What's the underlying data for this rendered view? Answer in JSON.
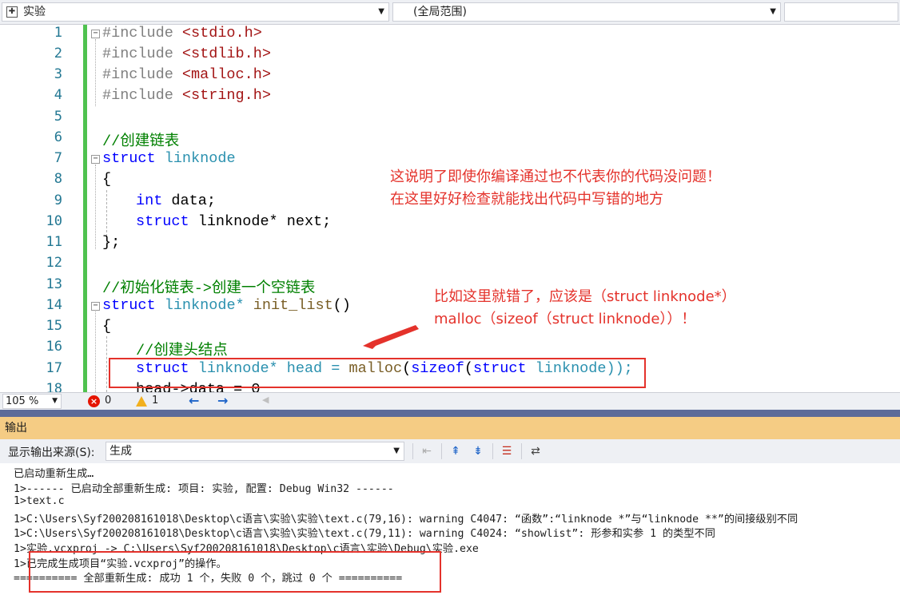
{
  "navbar": {
    "project": "实验",
    "scope": "(全局范围)"
  },
  "editor": {
    "line_numbers": [
      "1",
      "2",
      "3",
      "4",
      "5",
      "6",
      "7",
      "8",
      "9",
      "10",
      "11",
      "12",
      "13",
      "14",
      "15",
      "16",
      "17",
      "18"
    ],
    "lines": {
      "l1a": "#include ",
      "l1b": "<stdio.h>",
      "l2a": "#include ",
      "l2b": "<stdlib.h>",
      "l3a": "#include ",
      "l3b": "<malloc.h>",
      "l4a": "#include ",
      "l4b": "<string.h>",
      "l6": "//创建链表",
      "l7a": "struct",
      "l7b": " linknode",
      "l8": "{",
      "l9a": "int",
      "l9b": " data;",
      "l10a": "struct",
      "l10b": " linknode* next;",
      "l11": "};",
      "l13": "//初始化链表->创建一个空链表",
      "l14a": "struct",
      "l14b": " linknode* ",
      "l14c": "init_list",
      "l14d": "()",
      "l15": "{",
      "l16": "//创建头结点",
      "l17a": "struct",
      "l17b": " linknode* head = ",
      "l17c": "malloc",
      "l17d": "(",
      "l17e": "sizeof",
      "l17f": "(",
      "l17g": "struct",
      "l17h": " linknode));",
      "l18": "head->data = 0"
    },
    "annotations": {
      "note1_line1": "这说明了即使你编译通过也不代表你的代码没问题！",
      "note1_line2": "在这里好好检查就能找出代码中写错的地方",
      "note2_line1": "比如这里就错了，应该是（struct linknode*）",
      "note2_line2": "malloc（sizeof（struct linknode））！"
    }
  },
  "status": {
    "zoom": "105 %",
    "errors": "0",
    "warnings": "1"
  },
  "output": {
    "title": "输出",
    "source_label": "显示输出来源(S):",
    "source_value": "生成",
    "lines": [
      "已启动重新生成…",
      "1>------ 已启动全部重新生成: 项目: 实验, 配置: Debug Win32 ------",
      "1>text.c",
      "1>C:\\Users\\Syf200208161018\\Desktop\\c语言\\实验\\实验\\text.c(79,16): warning C4047: “函数”:“linknode *”与“linknode **”的间接级别不同",
      "1>C:\\Users\\Syf200208161018\\Desktop\\c语言\\实验\\实验\\text.c(79,11): warning C4024: “showlist”: 形参和实参 1 的类型不同",
      "1>实验.vcxproj -> C:\\Users\\Syf200208161018\\Desktop\\c语言\\实验\\Debug\\实验.exe",
      "1>已完成生成项目“实验.vcxproj”的操作。",
      "========== 全部重新生成: 成功 1 个，失败 0 个，跳过 0 个 =========="
    ]
  }
}
